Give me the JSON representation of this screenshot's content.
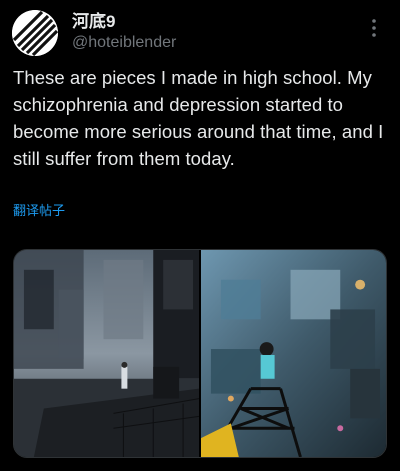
{
  "post": {
    "display_name": "河底9",
    "handle": "@hoteiblender",
    "text": "These are pieces I made in high school. My schizophrenia and depression started to become more serious around that time, and I still suffer from them today.",
    "translate_label": "翻译帖子"
  },
  "icons": {
    "avatar": "avatar-diagonal-stripes",
    "more": "more-vertical-icon"
  },
  "media": [
    {
      "name": "city-rooftop-figure-artwork"
    },
    {
      "name": "tower-looking-down-city-artwork"
    }
  ],
  "colors": {
    "background": "#000000",
    "text": "#e7e9ea",
    "secondary": "#71767b",
    "link": "#1d9bf0"
  }
}
